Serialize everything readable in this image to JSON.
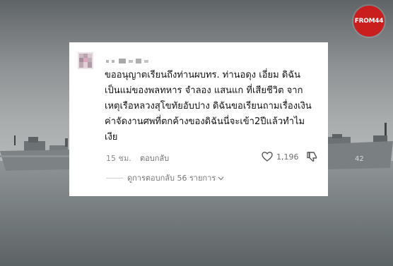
{
  "logo": {
    "text": "FROM44",
    "color": "#c81e1e"
  },
  "comment": {
    "text_lines": [
      "ขออนุญาตเรียนถึงท่านผบทร. ท่านอดุง เอี่ยม ดิฉัน",
      "เป็นแม่ของพลทหาร จำลอง แสนแก ที่เสียชีวิต จาก",
      "เหตุเรือหลวงสุโขทัยอับปาง ดิฉันขอเรียนถามเรื่องเงิน",
      "ค่าจัดงานศพที่ตกค้างของดิฉันนี่จะเข้า2ปีแล้วทำไม",
      "เงีย"
    ],
    "time": "15 ชม.",
    "reply_label": "ตอบกลับ",
    "like_count": "1,196",
    "view_replies_label": "ดูการตอบกลับ 56 รายการ"
  },
  "icons": {
    "heart": "heart-icon",
    "dislike": "dislike-icon",
    "chevron": "chevron-down-icon"
  }
}
